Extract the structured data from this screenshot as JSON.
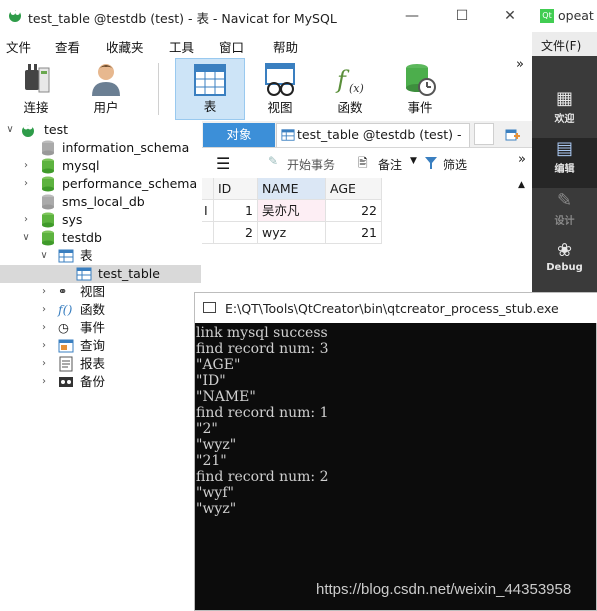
{
  "navicat": {
    "window_title": "test_table @testdb (test) - 表 - Navicat for MySQL",
    "menu": [
      "文件",
      "查看",
      "收藏夹",
      "工具",
      "窗口",
      "帮助"
    ],
    "toolbar": [
      {
        "label": "连接",
        "icon": "plug-icon"
      },
      {
        "label": "用户",
        "icon": "user-icon"
      },
      {
        "label": "表",
        "icon": "table-icon",
        "active": true
      },
      {
        "label": "视图",
        "icon": "view-icon"
      },
      {
        "label": "函数",
        "icon": "function-icon"
      },
      {
        "label": "事件",
        "icon": "event-icon"
      }
    ],
    "toolbar_more": "»"
  },
  "tree": {
    "root": "test",
    "items": [
      {
        "label": "information_schema"
      },
      {
        "label": "mysql"
      },
      {
        "label": "performance_schema"
      },
      {
        "label": "sms_local_db"
      },
      {
        "label": "sys"
      },
      {
        "label": "testdb"
      }
    ],
    "testdb_children": {
      "tables_label": "表",
      "selected_table": "test_table",
      "others": [
        "视图",
        "函数",
        "事件",
        "查询",
        "报表",
        "备份"
      ]
    }
  },
  "tabs": {
    "object_tab": "对象",
    "table_tab": "test_table @testdb (test) - 表"
  },
  "subtoolbar": {
    "begin_txn": "开始事务",
    "remark": "备注",
    "filter": "筛选"
  },
  "grid": {
    "columns": [
      "ID",
      "NAME",
      "AGE"
    ],
    "rows": [
      {
        "id": "1",
        "name": "吴亦凡",
        "age": "22"
      },
      {
        "id": "2",
        "name": "wyz",
        "age": "21"
      }
    ],
    "cursor_marker": "I"
  },
  "qt": {
    "title": "opeat",
    "menu": "文件(F)",
    "modes": [
      "欢迎",
      "编辑",
      "设计",
      "Debug"
    ]
  },
  "console": {
    "title": "E:\\QT\\Tools\\QtCreator\\bin\\qtcreator_process_stub.exe",
    "lines": [
      "link mysql success",
      "find record num: 3",
      "\"AGE\"",
      "\"ID\"",
      "\"NAME\"",
      "find record num: 1",
      "\"2\"",
      "\"wyz\"",
      "\"21\"",
      "find record num: 2",
      "\"wyf\"",
      "\"wyz\""
    ]
  },
  "watermark": "https://blog.csdn.net/weixin_44353958"
}
